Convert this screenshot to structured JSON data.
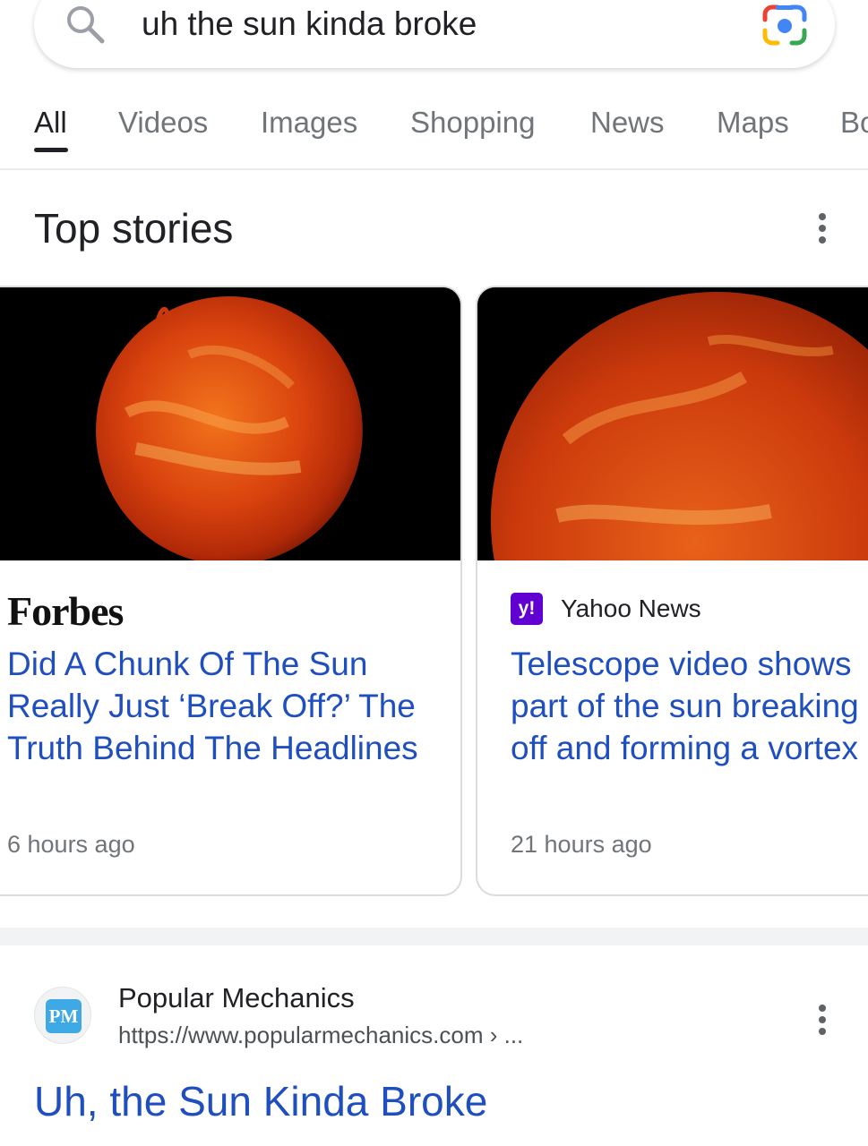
{
  "search": {
    "query": "uh the sun kinda broke"
  },
  "tabs": [
    {
      "label": "All",
      "active": true
    },
    {
      "label": "Videos"
    },
    {
      "label": "Images"
    },
    {
      "label": "Shopping"
    },
    {
      "label": "News"
    },
    {
      "label": "Maps"
    },
    {
      "label": "Bo"
    }
  ],
  "top_stories": {
    "title": "Top stories",
    "cards": [
      {
        "source": "Forbes",
        "headline": "Did A Chunk Of The Sun Really Just ‘Break Off?’ The Truth Behind The Headlines",
        "time": "6 hours ago"
      },
      {
        "source": "Yahoo News",
        "source_badge": "y!",
        "headline_lines": [
          "Telescope video shows",
          "part of the sun breaking",
          "off and forming a vortex"
        ],
        "time": "21 hours ago"
      }
    ]
  },
  "result": {
    "site_logo_text": "PM",
    "site_name": "Popular Mechanics",
    "url": "https://www.popularmechanics.com › ...",
    "title": "Uh, the Sun Kinda Broke"
  },
  "colors": {
    "link": "#1f4fbf",
    "yahoo": "#6001d2",
    "pm": "#3fa9e5"
  },
  "icons": [
    "search-icon",
    "google-lens-icon",
    "more-vert-icon",
    "sun-image"
  ]
}
